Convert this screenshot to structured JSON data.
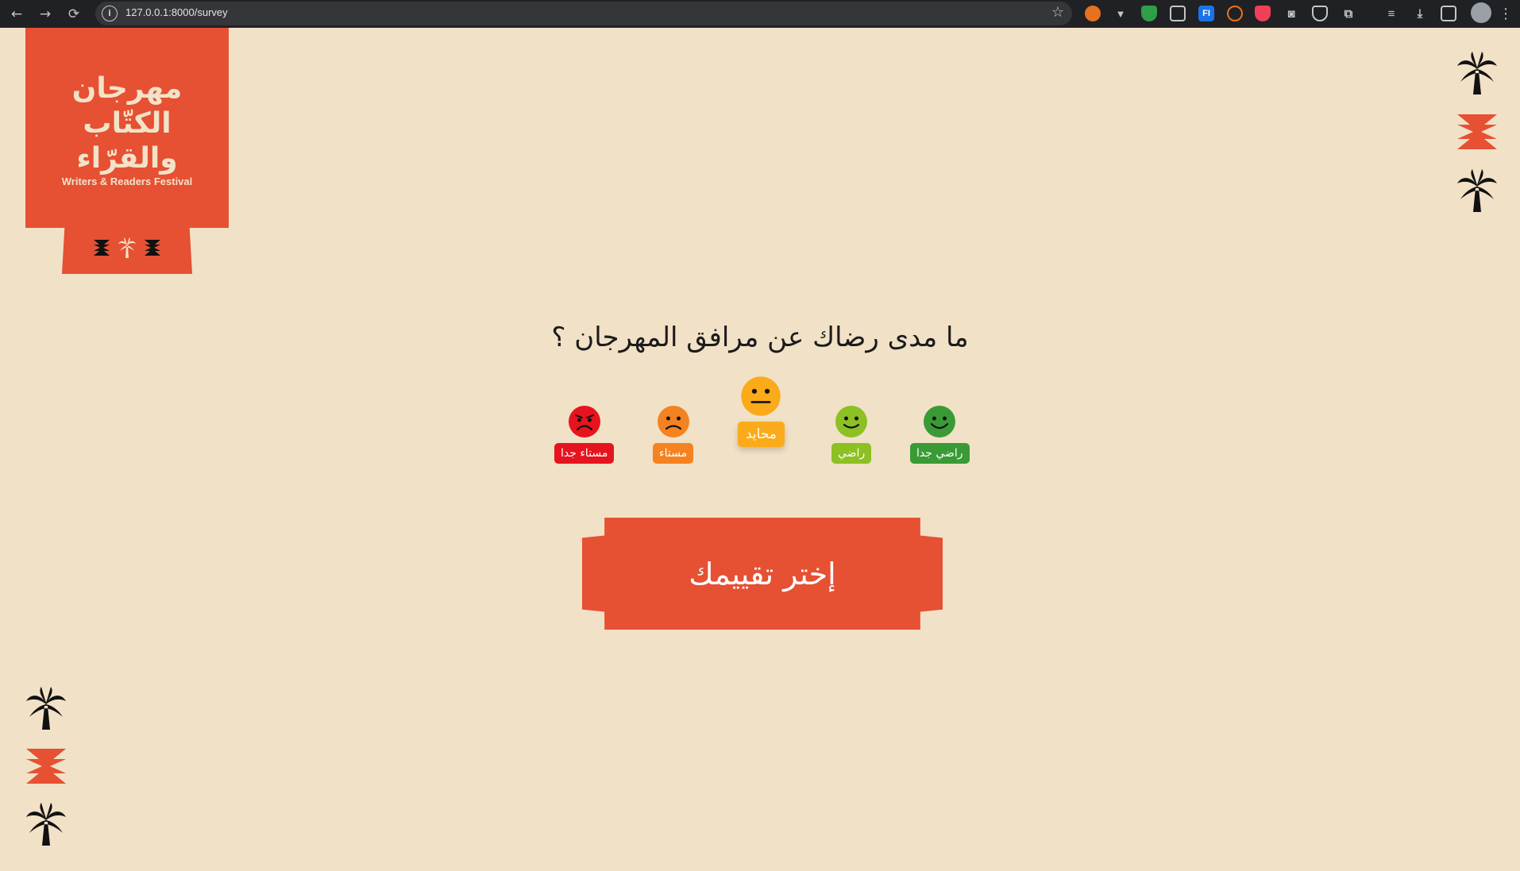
{
  "browser": {
    "url": "127.0.0.1:8000/survey",
    "nav": {
      "back": "←",
      "forward": "→",
      "reload": "⟳"
    },
    "extensions": [
      "orange-extension-icon",
      "vpn-extension-icon",
      "shield-extension-icon",
      "screen-extension-icon",
      "fi-extension-icon",
      "b-extension-icon",
      "pocket-extension-icon",
      "camera-extension-icon",
      "privacy-extension-icon",
      "puzzle-extension-icon",
      "media-icon",
      "download-icon",
      "sidebar-icon"
    ]
  },
  "logo": {
    "arabic_lines": [
      "مهرجان",
      "الكتّاب",
      "والقرّاء"
    ],
    "english": "Writers & Readers Festival"
  },
  "survey": {
    "question": "ما مدى رضاك عن مرافق المهرجان ؟",
    "options": [
      {
        "label": "راضي جدا",
        "color": "#3a9a35",
        "face": "happy"
      },
      {
        "label": "راضي",
        "color": "#8dc022",
        "face": "smile"
      },
      {
        "label": "محايد",
        "color": "#fbab19",
        "face": "neutral",
        "selected": true
      },
      {
        "label": "مستاء",
        "color": "#f58220",
        "face": "sad"
      },
      {
        "label": "مستاء جدا",
        "color": "#e5141e",
        "face": "very-sad"
      }
    ],
    "submit_label": "إختر تقييمك"
  },
  "colors": {
    "background": "#f1e1c6",
    "brand": "#e65033",
    "decor_dark": "#111111"
  }
}
